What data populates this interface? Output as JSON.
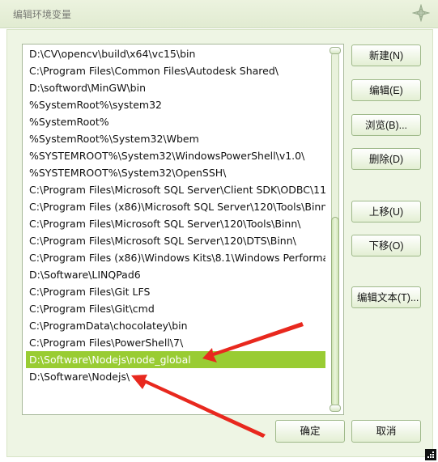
{
  "window": {
    "title": "编辑环境变量"
  },
  "paths": [
    "D:\\CV\\opencv\\build\\x64\\vc15\\bin",
    "C:\\Program Files\\Common Files\\Autodesk Shared\\",
    "D:\\softword\\MinGW\\bin",
    "%SystemRoot%\\system32",
    "%SystemRoot%",
    "%SystemRoot%\\System32\\Wbem",
    "%SYSTEMROOT%\\System32\\WindowsPowerShell\\v1.0\\",
    "%SYSTEMROOT%\\System32\\OpenSSH\\",
    "C:\\Program Files\\Microsoft SQL Server\\Client SDK\\ODBC\\11...",
    "C:\\Program Files (x86)\\Microsoft SQL Server\\120\\Tools\\Binn\\",
    "C:\\Program Files\\Microsoft SQL Server\\120\\Tools\\Binn\\",
    "C:\\Program Files\\Microsoft SQL Server\\120\\DTS\\Binn\\",
    "C:\\Program Files (x86)\\Windows Kits\\8.1\\Windows Performa...",
    "D:\\Software\\LINQPad6",
    "C:\\Program Files\\Git LFS",
    "C:\\Program Files\\Git\\cmd",
    "C:\\ProgramData\\chocolatey\\bin",
    "C:\\Program Files\\PowerShell\\7\\",
    "D:\\Software\\Nodejs\\node_global",
    "D:\\Software\\Nodejs\\"
  ],
  "selected_index": 18,
  "buttons": {
    "new": "新建(N)",
    "edit": "编辑(E)",
    "browse": "浏览(B)...",
    "delete": "删除(D)",
    "move_up": "上移(U)",
    "move_down": "下移(O)",
    "edit_text": "编辑文本(T)...",
    "ok": "确定",
    "cancel": "取消"
  },
  "colors": {
    "selection": "#99cc33",
    "annotation_arrow": "#e8281e"
  }
}
